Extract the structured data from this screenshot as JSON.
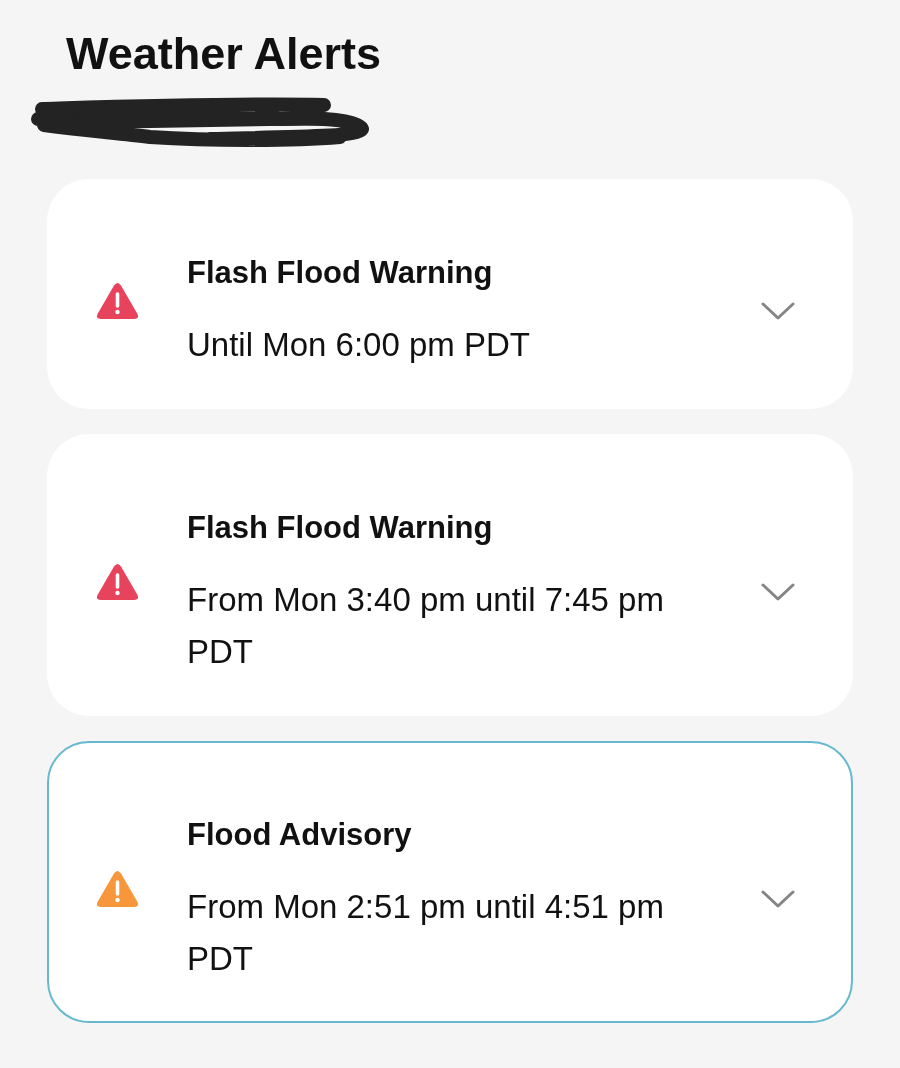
{
  "header": {
    "title": "Weather Alerts"
  },
  "alerts": [
    {
      "title": "Flash Flood Warning",
      "time": "Until Mon 6:00 pm PDT",
      "color": "#e8435c",
      "selected": false,
      "expanded": false
    },
    {
      "title": "Flash Flood Warning",
      "time": "From Mon 3:40 pm until 7:45 pm PDT",
      "color": "#e8435c",
      "selected": false,
      "expanded": false
    },
    {
      "title": "Flood Advisory",
      "time": "From Mon 2:51 pm until 4:51 pm PDT",
      "color": "#f7963a",
      "selected": true,
      "expanded": false
    }
  ]
}
